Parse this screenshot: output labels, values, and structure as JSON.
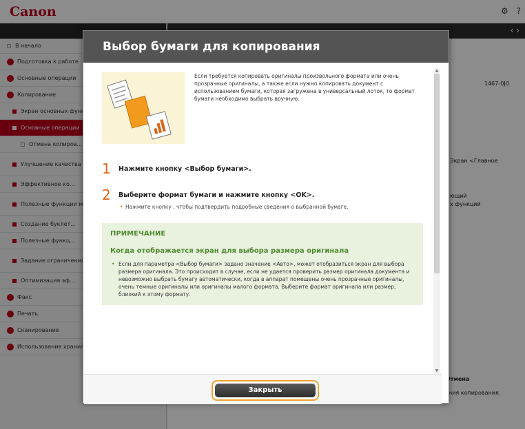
{
  "app": {
    "logo": "Canon",
    "top_icons": [
      "gear-icon",
      "help-icon"
    ]
  },
  "sidebar": {
    "items": [
      {
        "label": "В начало",
        "kind": "plain"
      },
      {
        "label": "Подготовка к работе",
        "kind": "bullet"
      },
      {
        "label": "Основные операции",
        "kind": "bullet"
      },
      {
        "label": "Копирование",
        "kind": "bullet"
      },
      {
        "label": "Экран основных функций",
        "kind": "sub"
      },
      {
        "label": "Основные операции",
        "kind": "active"
      },
      {
        "label": "Отмена копиров...",
        "kind": "sub2"
      },
      {
        "label": "Улучшение качества копирования",
        "kind": "sub"
      },
      {
        "label": "Эффективное ко...",
        "kind": "sub"
      },
      {
        "label": "Полезные функции материалов и устр...",
        "kind": "sub"
      },
      {
        "label": "Создание буклет...",
        "kind": "sub"
      },
      {
        "label": "Полезные функц...",
        "kind": "sub"
      },
      {
        "label": "Задание ограничений конфиденциальн...",
        "kind": "sub"
      },
      {
        "label": "Оптимизация эф...",
        "kind": "sub"
      },
      {
        "label": "Факс",
        "kind": "bullet"
      },
      {
        "label": "Печать",
        "kind": "bullet"
      },
      {
        "label": "Сканирование",
        "kind": "bullet"
      },
      {
        "label": "Использование хранилища аппарата",
        "kind": "bullet"
      }
    ]
  },
  "main": {
    "fragments": [
      {
        "text": "1467-0J0"
      },
      {
        "text": "Экран <Главное"
      },
      {
        "text": "ющий"
      },
      {
        "text": "х функций"
      },
      {
        "text": "Отмена"
      },
      {
        "text": "ния копирования."
      }
    ]
  },
  "modal": {
    "title": "Выбор бумаги для копирования",
    "intro": "Если требуется копировать оригиналы произвольного формата или очень прозрачные оригиналы, а также если нужно копировать документ с использованием бумаги, которая загружена в универсальный лоток, то формат бумаги необходимо выбрать вручную.",
    "steps": [
      {
        "num": "1",
        "text": "Нажмите кнопку <Выбор бумаги>."
      },
      {
        "num": "2",
        "text": "Выберите формат бумаги и нажмите кнопку <OK>.",
        "bullet": "Нажмите кнопку , чтобы подтвердить подробные сведения о выбранной бумаге."
      }
    ],
    "note": {
      "label": "ПРИМЕЧАНИЕ",
      "title": "Когда отображается экран для выбора размера оригинала",
      "text": "Если для параметра <Выбор бумаги> задано значение <Авто>, может отобразиться экран для выбора размера оригинала. Это происходит в случае, если не удается проверить размер оригинала документа и невозможно выбрать бумагу автоматически, когда в аппарат помещены очень прозрачные оригиналы, очень темные оригиналы или оригиналы малого формата. Выберите формат оригинала или размер, близкий к этому формату."
    },
    "close_label": "Закрыть"
  },
  "colors": {
    "brand_red": "#c0001c",
    "step_orange": "#e06316",
    "note_green": "#4e8a2e",
    "highlight": "#f0a030"
  }
}
